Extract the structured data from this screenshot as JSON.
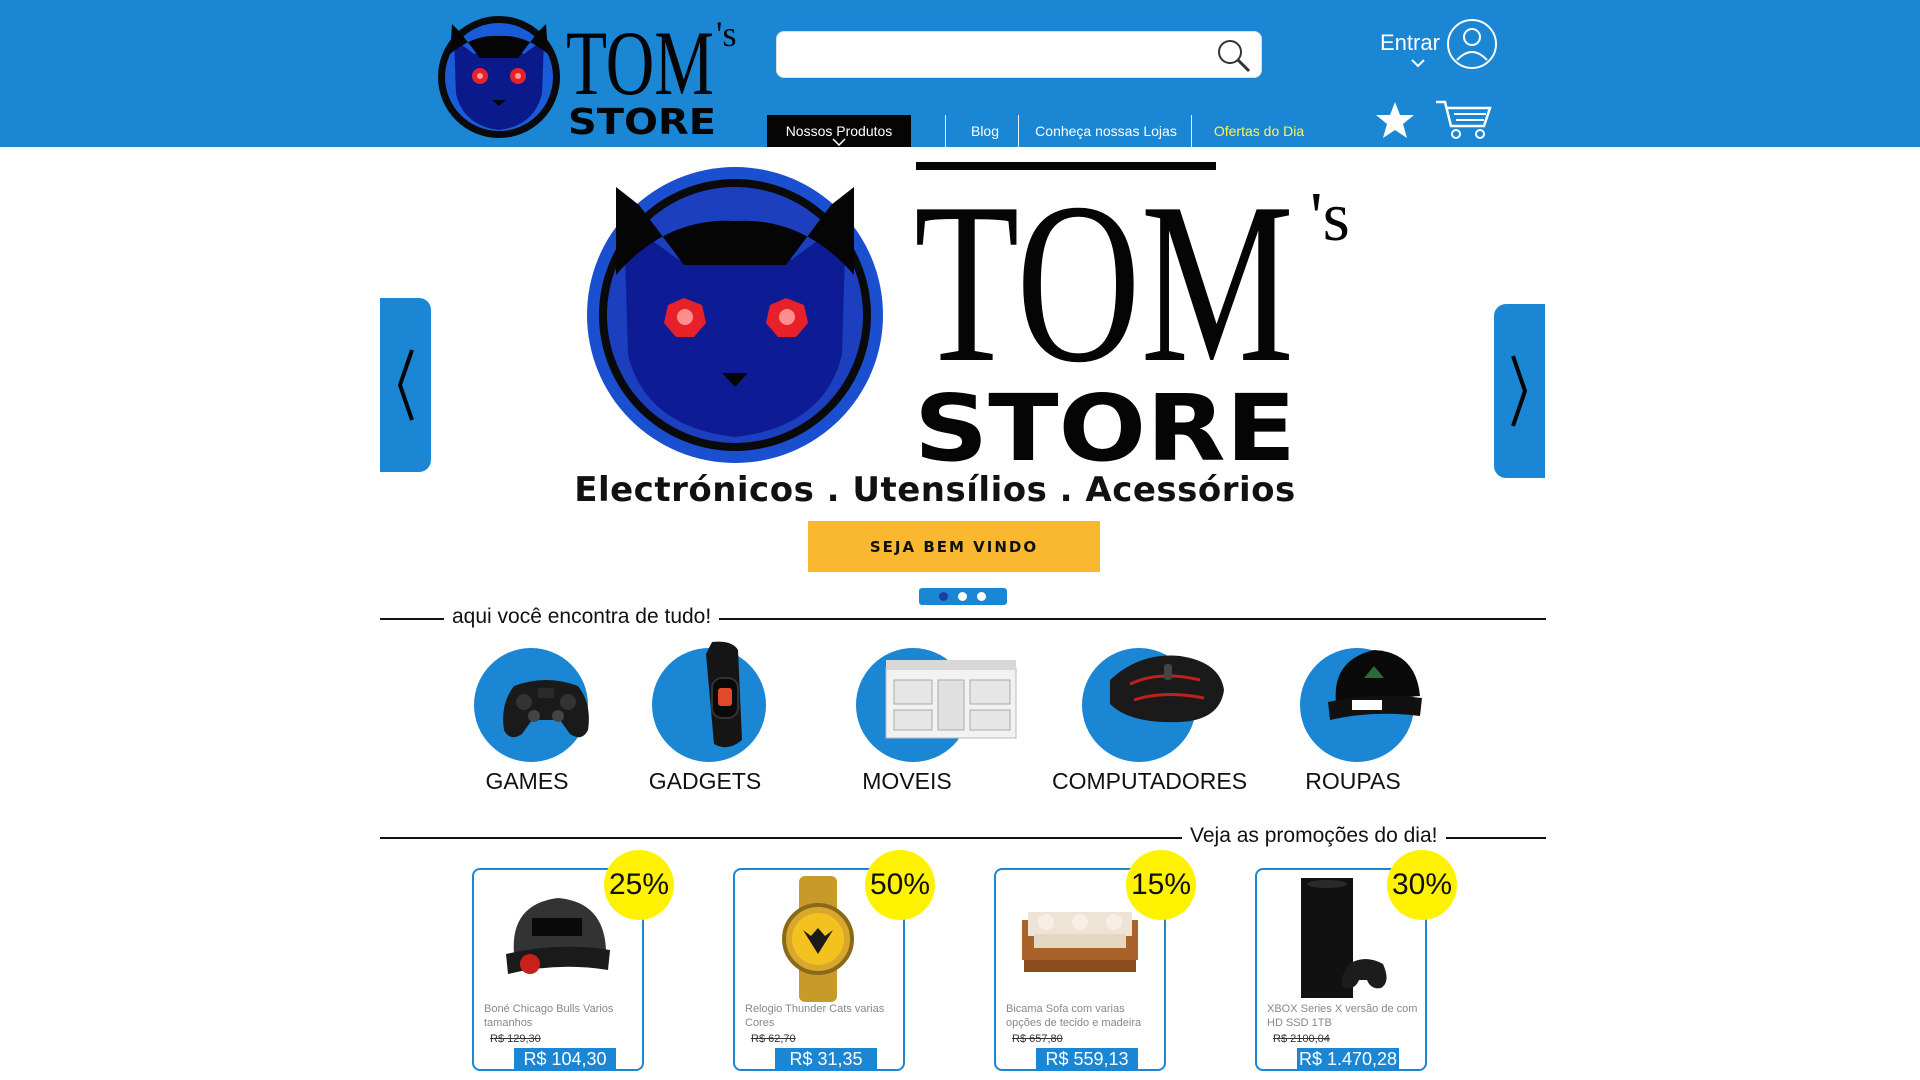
{
  "brand": {
    "logo_title": "TOM",
    "logo_suffix": "'s",
    "logo_sub": "STORE"
  },
  "search": {
    "value": "",
    "placeholder": ""
  },
  "account": {
    "login_label": "Entrar"
  },
  "nav": {
    "items": [
      {
        "label": "Nossos Produtos"
      },
      {
        "label": "Blog"
      },
      {
        "label": "Conheça nossas Lojas"
      },
      {
        "label": "Ofertas do Dia"
      }
    ]
  },
  "banner": {
    "title": "TOM",
    "suffix": "'s",
    "sub": "STORE",
    "tagline": "Electrónicos . Utensílios . Acessórios",
    "cta": "SEJA BEM VINDO",
    "slide_count": 3,
    "active_slide": 1
  },
  "categories": {
    "title": "aqui você encontra de tudo!",
    "items": [
      {
        "label": "GAMES"
      },
      {
        "label": "GADGETS"
      },
      {
        "label": "MOVEIS"
      },
      {
        "label": "COMPUTADORES"
      },
      {
        "label": "ROUPAS"
      }
    ]
  },
  "promos": {
    "title": "Veja as promoções do dia!",
    "items": [
      {
        "discount": "25%",
        "name": "Boné Chicago Bulls Varios tamanhos",
        "old_price": "R$ 129,30",
        "price": "R$ 104,30"
      },
      {
        "discount": "50%",
        "name": "Relogio Thunder Cats varias Cores",
        "old_price": "R$ 62,70",
        "price": "R$ 31,35"
      },
      {
        "discount": "15%",
        "name": "Bicama Sofa com varias opções de tecido e madeira",
        "old_price": "R$ 657,80",
        "price": "R$ 559,13"
      },
      {
        "discount": "30%",
        "name": "XBOX Series X versão de com HD SSD 1TB",
        "old_price": "R$ 2100,04",
        "price": "R$ 1.470,28"
      }
    ]
  },
  "colors": {
    "brand_blue": "#1a86d4",
    "nav_active": "#050505",
    "offer_text": "#fff35a",
    "cta": "#f9b82f",
    "badge": "#fff200",
    "cat_eye": "#e8202a"
  }
}
